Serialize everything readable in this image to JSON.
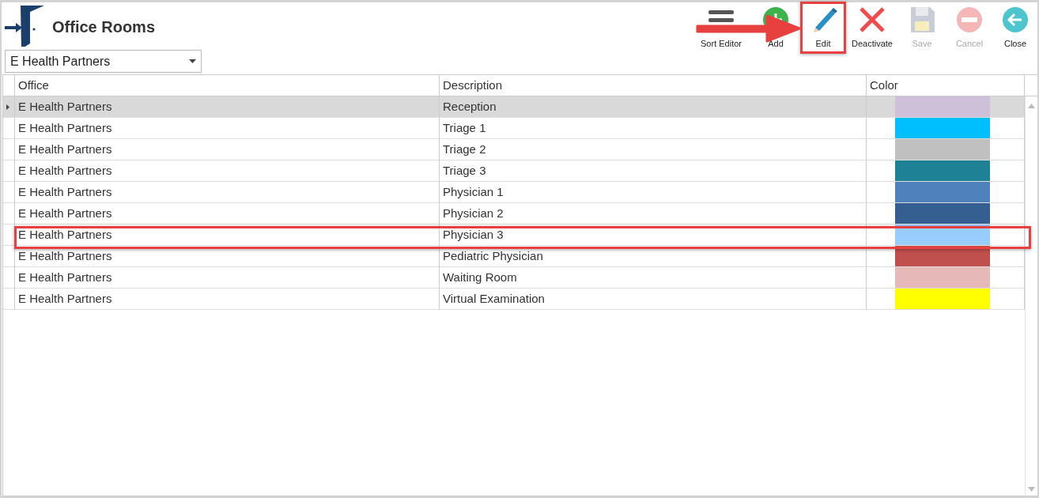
{
  "window": {
    "title": "Office Rooms"
  },
  "toolbar": [
    {
      "kind": "sort",
      "label": "Sort Editor",
      "disabled": false
    },
    {
      "kind": "add",
      "label": "Add",
      "disabled": false
    },
    {
      "kind": "edit",
      "label": "Edit",
      "disabled": false
    },
    {
      "kind": "deactivate",
      "label": "Deactivate",
      "disabled": false
    },
    {
      "kind": "save",
      "label": "Save",
      "disabled": true
    },
    {
      "kind": "cancel",
      "label": "Cancel",
      "disabled": true
    },
    {
      "kind": "close",
      "label": "Close",
      "disabled": false
    }
  ],
  "office_select": {
    "value": "E Health Partners"
  },
  "table": {
    "columns": [
      "Office",
      "Description",
      "Color"
    ],
    "rows": [
      {
        "office": "E Health Partners",
        "description": "Reception",
        "color": "#cdc0d8",
        "selected": true
      },
      {
        "office": "E Health Partners",
        "description": "Triage 1",
        "color": "#00bfff",
        "selected": false
      },
      {
        "office": "E Health Partners",
        "description": "Triage 2",
        "color": "#c0c0c0",
        "selected": false
      },
      {
        "office": "E Health Partners",
        "description": "Triage 3",
        "color": "#1e8196",
        "selected": false
      },
      {
        "office": "E Health Partners",
        "description": "Physician 1",
        "color": "#4f81bd",
        "selected": false
      },
      {
        "office": "E Health Partners",
        "description": "Physician 2",
        "color": "#365f91",
        "selected": false
      },
      {
        "office": "E Health Partners",
        "description": "Physician 3",
        "color": "#99ccff",
        "selected": false
      },
      {
        "office": "E Health Partners",
        "description": "Pediatric Physician",
        "color": "#c0504d",
        "selected": false
      },
      {
        "office": "E Health Partners",
        "description": "Waiting Room",
        "color": "#e6b8b7",
        "selected": false
      },
      {
        "office": "E Health Partners",
        "description": "Virtual Examination",
        "color": "#ffff00",
        "selected": false
      }
    ]
  }
}
